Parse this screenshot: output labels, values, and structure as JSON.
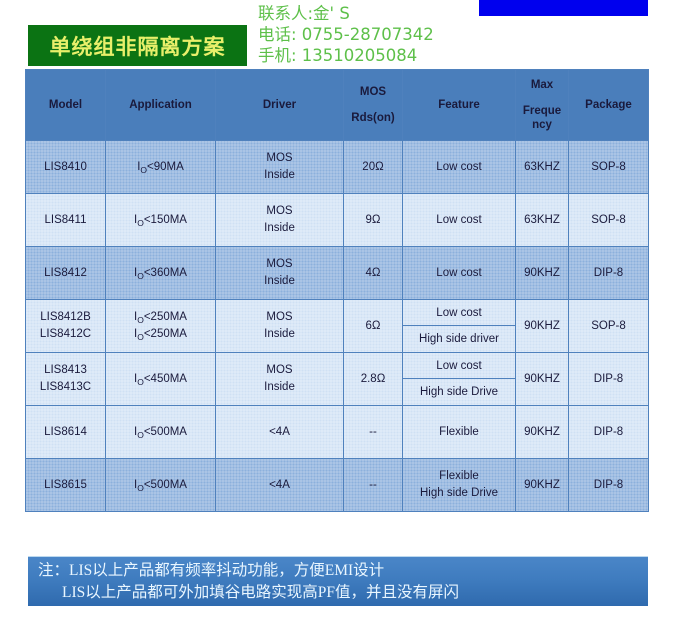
{
  "decor": {
    "top_bar_color": "#0000ee"
  },
  "title": {
    "text": "单绕组非隔离方案",
    "bg_color": "#0b7313",
    "text_color": "#e8ef6a"
  },
  "contact": {
    "person": "联系人:金' S",
    "phone": "电话: 0755-28707342",
    "mobile": "手机: 13510205084",
    "text_color": "#5ec04a"
  },
  "table": {
    "header_bg": "#4a7ebb",
    "row_dark": "#8cb0dc",
    "row_light": "#cfe0f4",
    "headers": {
      "model": "Model",
      "application": "Application",
      "driver": "Driver",
      "mos_top": "MOS",
      "mos_bottom": "Rds(on)",
      "feature": "Feature",
      "maxfreq_top": "Max",
      "maxfreq_bottom": "Freque ncy",
      "package": "Package"
    },
    "rows": [
      {
        "shade": "dark",
        "model": "LIS8410",
        "app_pre": "I",
        "app_sub": "O",
        "app_post": "<90MA",
        "driver_top": "MOS",
        "driver_bottom": "Inside",
        "rds": "20Ω",
        "feature": "Low cost",
        "freq": "63KHZ",
        "package": "SOP-8"
      },
      {
        "shade": "light",
        "model": "LIS8411",
        "app_pre": "I",
        "app_sub": "O",
        "app_post": "<150MA",
        "driver_top": "MOS",
        "driver_bottom": "Inside",
        "rds": "9Ω",
        "feature": "Low cost",
        "freq": "63KHZ",
        "package": "SOP-8"
      },
      {
        "shade": "dark",
        "model": "LIS8412",
        "app_pre": "I",
        "app_sub": "O",
        "app_post": "<360MA",
        "driver_top": "MOS",
        "driver_bottom": "Inside",
        "rds": "4Ω",
        "feature": "Low cost",
        "freq": "90KHZ",
        "package": "DIP-8"
      },
      {
        "shade": "light",
        "model_line1": "LIS8412B",
        "model_line2": "LIS8412C",
        "app_pre": "I",
        "app_sub": "O",
        "app_post": "<250MA",
        "app2_pre": "I",
        "app2_sub": "O",
        "app2_post": "<250MA",
        "driver_top": "MOS",
        "driver_bottom": "Inside",
        "rds": "6Ω",
        "feature_top": "Low cost",
        "feature_bottom": "High side driver",
        "freq": "90KHZ",
        "package": "SOP-8"
      },
      {
        "shade": "light",
        "model_line1": "LIS8413",
        "model_line2": "LIS8413C",
        "app_pre": "I",
        "app_sub": "O",
        "app_post": "<450MA",
        "driver_top": "MOS",
        "driver_bottom": "Inside",
        "rds": "2.8Ω",
        "feature_top": "Low cost",
        "feature_bottom": "High side Drive",
        "freq": "90KHZ",
        "package": "DIP-8"
      },
      {
        "shade": "light",
        "model": "LIS8614",
        "app_pre": "I",
        "app_sub": "O",
        "app_post": "<500MA",
        "driver_top": "<4A",
        "driver_bottom": "",
        "rds": "--",
        "feature": "Flexible",
        "freq": "90KHZ",
        "package": "DIP-8"
      },
      {
        "shade": "dark",
        "model": "LIS8615",
        "app_pre": "I",
        "app_sub": "O",
        "app_post": "<500MA",
        "driver_top": "<4A",
        "driver_bottom": "",
        "rds": "--",
        "feature_line1": "Flexible",
        "feature_line2": "High side Drive",
        "freq": "90KHZ",
        "package": "DIP-8"
      }
    ]
  },
  "note": {
    "line1": "注：LIS以上产品都有频率抖动功能，方便EMI设计",
    "line2": "LIS以上产品都可外加填谷电路实现高PF值，并且没有屏闪",
    "text_color": "#e9f6ff"
  }
}
